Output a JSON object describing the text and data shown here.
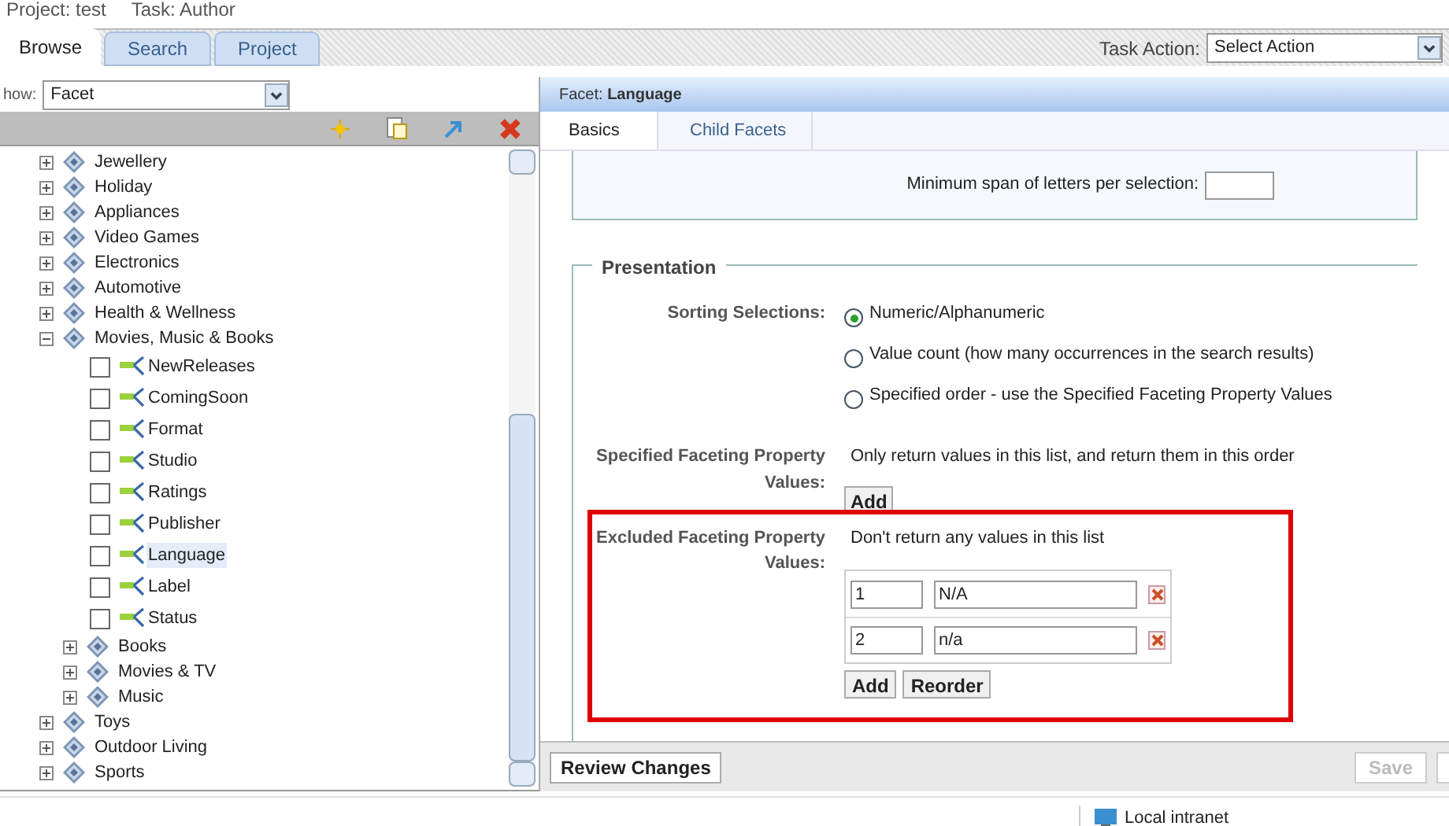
{
  "header": {
    "project": "Project: test",
    "task": "Task: Author"
  },
  "tabs": [
    {
      "label": "Browse",
      "selected": true
    },
    {
      "label": "Search",
      "selected": false
    },
    {
      "label": "Project",
      "selected": false
    }
  ],
  "task_action": {
    "label": "Task Action:",
    "value": "Select Action"
  },
  "show": {
    "label": "how:",
    "value": "Facet"
  },
  "tree": [
    {
      "label": "Jewellery",
      "kind": "category",
      "expanded": false
    },
    {
      "label": "Holiday",
      "kind": "category",
      "expanded": false
    },
    {
      "label": "Appliances",
      "kind": "category",
      "expanded": false
    },
    {
      "label": "Video Games",
      "kind": "category",
      "expanded": false
    },
    {
      "label": "Electronics",
      "kind": "category",
      "expanded": false
    },
    {
      "label": "Automotive",
      "kind": "category",
      "expanded": false
    },
    {
      "label": "Health & Wellness",
      "kind": "category",
      "expanded": false
    },
    {
      "label": "Movies, Music & Books",
      "kind": "category",
      "expanded": true,
      "children": [
        {
          "label": "NewReleases",
          "kind": "facet",
          "checked": false,
          "selected": false
        },
        {
          "label": "ComingSoon",
          "kind": "facet",
          "checked": false,
          "selected": false
        },
        {
          "label": "Format",
          "kind": "facet",
          "checked": false,
          "selected": false
        },
        {
          "label": "Studio",
          "kind": "facet",
          "checked": false,
          "selected": false
        },
        {
          "label": "Ratings",
          "kind": "facet",
          "checked": false,
          "selected": false
        },
        {
          "label": "Publisher",
          "kind": "facet",
          "checked": false,
          "selected": false
        },
        {
          "label": "Language",
          "kind": "facet",
          "checked": false,
          "selected": true
        },
        {
          "label": "Label",
          "kind": "facet",
          "checked": false,
          "selected": false
        },
        {
          "label": "Status",
          "kind": "facet",
          "checked": false,
          "selected": false
        },
        {
          "label": "Books",
          "kind": "category",
          "expanded": false
        },
        {
          "label": "Movies & TV",
          "kind": "category",
          "expanded": false
        },
        {
          "label": "Music",
          "kind": "category",
          "expanded": false
        }
      ]
    },
    {
      "label": "Toys",
      "kind": "category",
      "expanded": false
    },
    {
      "label": "Outdoor Living",
      "kind": "category",
      "expanded": false
    },
    {
      "label": "Sports",
      "kind": "category",
      "expanded": false
    }
  ],
  "panel": {
    "title": "Facet: ",
    "title_bold": "Language",
    "tabs": [
      {
        "label": "Basics",
        "selected": true
      },
      {
        "label": "Child Facets",
        "selected": false
      }
    ],
    "min_span_label": "Minimum span of letters per selection:",
    "presentation": {
      "legend": "Presentation",
      "sorting_label": "Sorting Selections:",
      "sorting_options": [
        {
          "label": "Numeric/Alphanumeric",
          "selected": true
        },
        {
          "label": "Value count (how many occurrences in the search results)",
          "selected": false
        },
        {
          "label": "Specified order - use the Specified Faceting Property Values",
          "selected": false
        }
      ],
      "specified_label": "Specified Faceting Property Values:",
      "specified_hint": "Only return values in this list, and return them in this order",
      "specified_add": "Add",
      "excluded_label": "Excluded Faceting Property Values:",
      "excluded_hint": "Don't return any values in this list",
      "excluded_rows": [
        {
          "order": "1",
          "value": "N/A"
        },
        {
          "order": "2",
          "value": "n/a"
        }
      ],
      "excluded_buttons": [
        "Add",
        "Reorder"
      ]
    },
    "review": "Review Changes",
    "save": "Save"
  },
  "status_bar": {
    "zone": "Local intranet"
  }
}
